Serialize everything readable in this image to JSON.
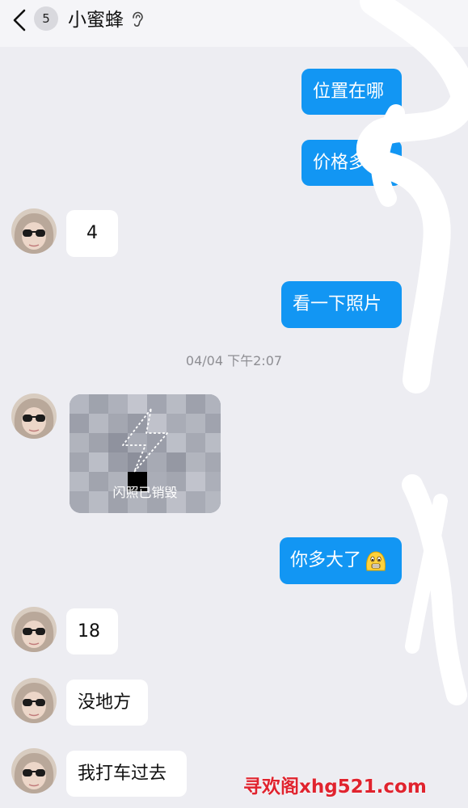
{
  "header": {
    "unread_badge": "5",
    "title": "小蜜蜂",
    "icon": "ear-icon"
  },
  "messages": [
    {
      "side": "out",
      "text": "位置在哪"
    },
    {
      "side": "out",
      "text": "价格多少"
    },
    {
      "side": "in",
      "text": "4"
    },
    {
      "side": "out",
      "text": "看一下照片"
    },
    {
      "side": "in",
      "type": "flash-photo",
      "text": "闪照已销毁"
    },
    {
      "side": "out",
      "text": "你多大了",
      "emoji": "worried-face"
    },
    {
      "side": "in",
      "text": "18"
    },
    {
      "side": "in",
      "text": "没地方"
    },
    {
      "side": "in",
      "text": "我打车过去"
    }
  ],
  "timestamp": "04/04 下午2:07",
  "watermark": "寻欢阁xhg521.com",
  "colors": {
    "background": "#ededf2",
    "outgoing_bubble": "#1296f3",
    "incoming_bubble": "#ffffff",
    "watermark": "#e0232e"
  }
}
